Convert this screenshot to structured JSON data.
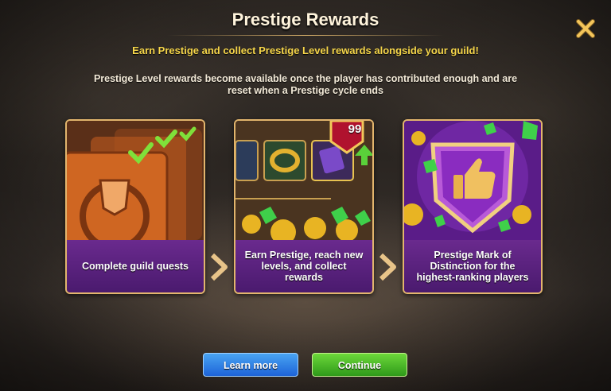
{
  "dialog": {
    "title": "Prestige Rewards",
    "subtitle": "Earn Prestige and collect Prestige Level rewards alongside your guild!",
    "description": "Prestige Level rewards become available once the player has contributed enough and are reset when a Prestige cycle ends",
    "close_icon": "close-x-icon"
  },
  "cards": [
    {
      "caption": "Complete guild quests",
      "art": "guild-quest-cards-with-checkmarks"
    },
    {
      "caption": "Earn Prestige, reach new levels, and collect rewards",
      "art": "reward-items-with-level-badge",
      "badge_level": "99"
    },
    {
      "caption": "Prestige Mark of Distinction for the highest-ranking players",
      "art": "prestige-mark-shield-thumbs-up"
    }
  ],
  "buttons": {
    "learn_more": "Learn more",
    "continue": "Continue"
  },
  "colors": {
    "title": "#fff4dc",
    "subtitle": "#f6d64a",
    "card_border": "#e2b56d",
    "caption_bg": "#5a1f7e",
    "learn_more_bg": "#2f7ee6",
    "continue_bg": "#45b526"
  }
}
